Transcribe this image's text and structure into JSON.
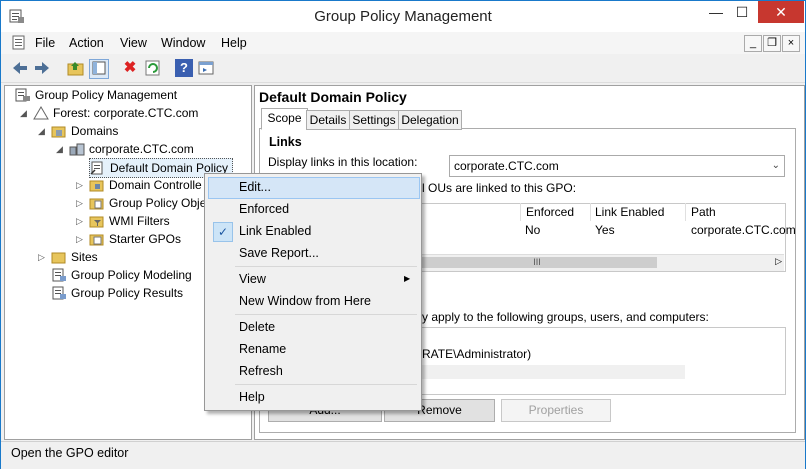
{
  "window": {
    "title": "Group Policy Management",
    "minimize": "—",
    "maximize": "☐",
    "close": "✕"
  },
  "menu": [
    "File",
    "Action",
    "View",
    "Window",
    "Help"
  ],
  "mdi": {
    "minimize": "_",
    "restore": "❐",
    "close": "×"
  },
  "toolbar": {
    "icons": [
      "back-icon",
      "forward-icon",
      "folder-up-icon",
      "show-hide-tree-icon",
      "delete-icon",
      "refresh-icon",
      "help-icon",
      "properties-icon"
    ]
  },
  "tree": {
    "root": "Group Policy Management",
    "forest": "Forest: corporate.CTC.com",
    "domains": "Domains",
    "domain": "corporate.CTC.com",
    "default_policy": "Default Domain Policy",
    "domain_controllers": "Domain Controlle",
    "gpo": "Group Policy Obje",
    "wmi": "WMI Filters",
    "starter": "Starter GPOs",
    "sites": "Sites",
    "modeling": "Group Policy Modeling",
    "results": "Group Policy Results"
  },
  "detail": {
    "title": "Default Domain Policy",
    "tabs": [
      "Scope",
      "Details",
      "Settings",
      "Delegation"
    ],
    "links_heading": "Links",
    "display_links_label": "Display links in this location:",
    "location_value": "corporate.CTC.com",
    "linked_text": "l OUs are linked to this GPO:",
    "columns": [
      "Enforced",
      "Link Enabled",
      "Path"
    ],
    "row": {
      "enforced": "No",
      "link_enabled": "Yes",
      "path": "corporate.CTC.com"
    },
    "scroll_thumb": "III",
    "filter_text": "y apply to the following groups, users, and computers:",
    "filter_row": "RATE\\Administrator)",
    "buttons": {
      "add": "Add...",
      "remove": "Remove",
      "properties": "Properties"
    }
  },
  "context_menu": {
    "items": [
      "Edit...",
      "Enforced",
      "Link Enabled",
      "Save Report...",
      "View",
      "New Window from Here",
      "Delete",
      "Rename",
      "Refresh",
      "Help"
    ],
    "check": "✓",
    "submenu_arrow": "▶"
  },
  "status": "Open the GPO editor"
}
